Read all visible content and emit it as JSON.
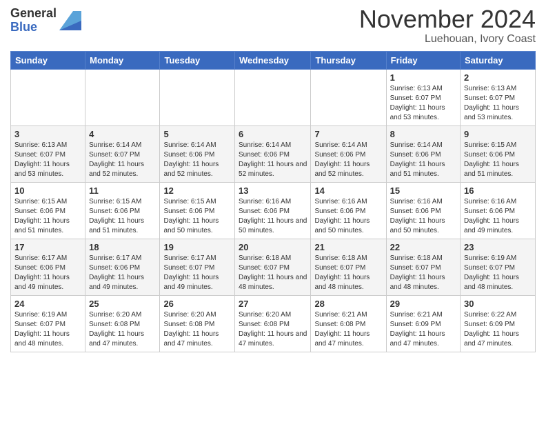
{
  "header": {
    "logo_general": "General",
    "logo_blue": "Blue",
    "month_title": "November 2024",
    "location": "Luehouan, Ivory Coast"
  },
  "weekdays": [
    "Sunday",
    "Monday",
    "Tuesday",
    "Wednesday",
    "Thursday",
    "Friday",
    "Saturday"
  ],
  "weeks": [
    [
      {
        "day": "",
        "sunrise": "",
        "sunset": "",
        "daylight": "",
        "empty": true
      },
      {
        "day": "",
        "sunrise": "",
        "sunset": "",
        "daylight": "",
        "empty": true
      },
      {
        "day": "",
        "sunrise": "",
        "sunset": "",
        "daylight": "",
        "empty": true
      },
      {
        "day": "",
        "sunrise": "",
        "sunset": "",
        "daylight": "",
        "empty": true
      },
      {
        "day": "",
        "sunrise": "",
        "sunset": "",
        "daylight": "",
        "empty": true
      },
      {
        "day": "1",
        "sunrise": "Sunrise: 6:13 AM",
        "sunset": "Sunset: 6:07 PM",
        "daylight": "Daylight: 11 hours and 53 minutes.",
        "empty": false
      },
      {
        "day": "2",
        "sunrise": "Sunrise: 6:13 AM",
        "sunset": "Sunset: 6:07 PM",
        "daylight": "Daylight: 11 hours and 53 minutes.",
        "empty": false
      }
    ],
    [
      {
        "day": "3",
        "sunrise": "Sunrise: 6:13 AM",
        "sunset": "Sunset: 6:07 PM",
        "daylight": "Daylight: 11 hours and 53 minutes.",
        "empty": false
      },
      {
        "day": "4",
        "sunrise": "Sunrise: 6:14 AM",
        "sunset": "Sunset: 6:07 PM",
        "daylight": "Daylight: 11 hours and 52 minutes.",
        "empty": false
      },
      {
        "day": "5",
        "sunrise": "Sunrise: 6:14 AM",
        "sunset": "Sunset: 6:06 PM",
        "daylight": "Daylight: 11 hours and 52 minutes.",
        "empty": false
      },
      {
        "day": "6",
        "sunrise": "Sunrise: 6:14 AM",
        "sunset": "Sunset: 6:06 PM",
        "daylight": "Daylight: 11 hours and 52 minutes.",
        "empty": false
      },
      {
        "day": "7",
        "sunrise": "Sunrise: 6:14 AM",
        "sunset": "Sunset: 6:06 PM",
        "daylight": "Daylight: 11 hours and 52 minutes.",
        "empty": false
      },
      {
        "day": "8",
        "sunrise": "Sunrise: 6:14 AM",
        "sunset": "Sunset: 6:06 PM",
        "daylight": "Daylight: 11 hours and 51 minutes.",
        "empty": false
      },
      {
        "day": "9",
        "sunrise": "Sunrise: 6:15 AM",
        "sunset": "Sunset: 6:06 PM",
        "daylight": "Daylight: 11 hours and 51 minutes.",
        "empty": false
      }
    ],
    [
      {
        "day": "10",
        "sunrise": "Sunrise: 6:15 AM",
        "sunset": "Sunset: 6:06 PM",
        "daylight": "Daylight: 11 hours and 51 minutes.",
        "empty": false
      },
      {
        "day": "11",
        "sunrise": "Sunrise: 6:15 AM",
        "sunset": "Sunset: 6:06 PM",
        "daylight": "Daylight: 11 hours and 51 minutes.",
        "empty": false
      },
      {
        "day": "12",
        "sunrise": "Sunrise: 6:15 AM",
        "sunset": "Sunset: 6:06 PM",
        "daylight": "Daylight: 11 hours and 50 minutes.",
        "empty": false
      },
      {
        "day": "13",
        "sunrise": "Sunrise: 6:16 AM",
        "sunset": "Sunset: 6:06 PM",
        "daylight": "Daylight: 11 hours and 50 minutes.",
        "empty": false
      },
      {
        "day": "14",
        "sunrise": "Sunrise: 6:16 AM",
        "sunset": "Sunset: 6:06 PM",
        "daylight": "Daylight: 11 hours and 50 minutes.",
        "empty": false
      },
      {
        "day": "15",
        "sunrise": "Sunrise: 6:16 AM",
        "sunset": "Sunset: 6:06 PM",
        "daylight": "Daylight: 11 hours and 50 minutes.",
        "empty": false
      },
      {
        "day": "16",
        "sunrise": "Sunrise: 6:16 AM",
        "sunset": "Sunset: 6:06 PM",
        "daylight": "Daylight: 11 hours and 49 minutes.",
        "empty": false
      }
    ],
    [
      {
        "day": "17",
        "sunrise": "Sunrise: 6:17 AM",
        "sunset": "Sunset: 6:06 PM",
        "daylight": "Daylight: 11 hours and 49 minutes.",
        "empty": false
      },
      {
        "day": "18",
        "sunrise": "Sunrise: 6:17 AM",
        "sunset": "Sunset: 6:06 PM",
        "daylight": "Daylight: 11 hours and 49 minutes.",
        "empty": false
      },
      {
        "day": "19",
        "sunrise": "Sunrise: 6:17 AM",
        "sunset": "Sunset: 6:07 PM",
        "daylight": "Daylight: 11 hours and 49 minutes.",
        "empty": false
      },
      {
        "day": "20",
        "sunrise": "Sunrise: 6:18 AM",
        "sunset": "Sunset: 6:07 PM",
        "daylight": "Daylight: 11 hours and 48 minutes.",
        "empty": false
      },
      {
        "day": "21",
        "sunrise": "Sunrise: 6:18 AM",
        "sunset": "Sunset: 6:07 PM",
        "daylight": "Daylight: 11 hours and 48 minutes.",
        "empty": false
      },
      {
        "day": "22",
        "sunrise": "Sunrise: 6:18 AM",
        "sunset": "Sunset: 6:07 PM",
        "daylight": "Daylight: 11 hours and 48 minutes.",
        "empty": false
      },
      {
        "day": "23",
        "sunrise": "Sunrise: 6:19 AM",
        "sunset": "Sunset: 6:07 PM",
        "daylight": "Daylight: 11 hours and 48 minutes.",
        "empty": false
      }
    ],
    [
      {
        "day": "24",
        "sunrise": "Sunrise: 6:19 AM",
        "sunset": "Sunset: 6:07 PM",
        "daylight": "Daylight: 11 hours and 48 minutes.",
        "empty": false
      },
      {
        "day": "25",
        "sunrise": "Sunrise: 6:20 AM",
        "sunset": "Sunset: 6:08 PM",
        "daylight": "Daylight: 11 hours and 47 minutes.",
        "empty": false
      },
      {
        "day": "26",
        "sunrise": "Sunrise: 6:20 AM",
        "sunset": "Sunset: 6:08 PM",
        "daylight": "Daylight: 11 hours and 47 minutes.",
        "empty": false
      },
      {
        "day": "27",
        "sunrise": "Sunrise: 6:20 AM",
        "sunset": "Sunset: 6:08 PM",
        "daylight": "Daylight: 11 hours and 47 minutes.",
        "empty": false
      },
      {
        "day": "28",
        "sunrise": "Sunrise: 6:21 AM",
        "sunset": "Sunset: 6:08 PM",
        "daylight": "Daylight: 11 hours and 47 minutes.",
        "empty": false
      },
      {
        "day": "29",
        "sunrise": "Sunrise: 6:21 AM",
        "sunset": "Sunset: 6:09 PM",
        "daylight": "Daylight: 11 hours and 47 minutes.",
        "empty": false
      },
      {
        "day": "30",
        "sunrise": "Sunrise: 6:22 AM",
        "sunset": "Sunset: 6:09 PM",
        "daylight": "Daylight: 11 hours and 47 minutes.",
        "empty": false
      }
    ]
  ]
}
